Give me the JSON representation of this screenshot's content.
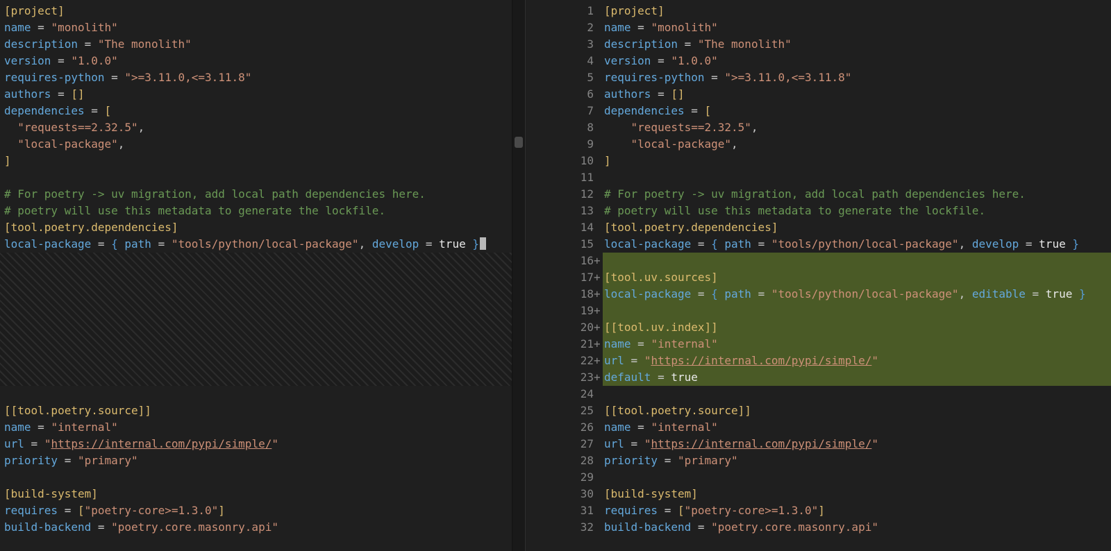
{
  "colors": {
    "background": "#1f1f1f",
    "added_line_background": "#4a5a26",
    "line_number": "#848484",
    "table_header": "#dcbb6e",
    "key": "#64a9dd",
    "string": "#ce9178",
    "comment": "#6a9955",
    "boolean": "#e9e9e9",
    "brace": "#569cd6",
    "scrollbar_thumb": "#4a4a4a"
  },
  "editor": {
    "left": {
      "lines": [
        {
          "tokens": [
            [
              "header",
              "[project]"
            ]
          ]
        },
        {
          "tokens": [
            [
              "key",
              "name"
            ],
            [
              "op",
              " = "
            ],
            [
              "str",
              "\"monolith\""
            ]
          ]
        },
        {
          "tokens": [
            [
              "key",
              "description"
            ],
            [
              "op",
              " = "
            ],
            [
              "str",
              "\"The monolith\""
            ]
          ]
        },
        {
          "tokens": [
            [
              "key",
              "version"
            ],
            [
              "op",
              " = "
            ],
            [
              "str",
              "\"1.0.0\""
            ]
          ]
        },
        {
          "tokens": [
            [
              "key",
              "requires-python"
            ],
            [
              "op",
              " = "
            ],
            [
              "str",
              "\">=3.11.0,<=3.11.8\""
            ]
          ]
        },
        {
          "tokens": [
            [
              "key",
              "authors"
            ],
            [
              "op",
              " = "
            ],
            [
              "bracket",
              "[]"
            ]
          ]
        },
        {
          "tokens": [
            [
              "key",
              "dependencies"
            ],
            [
              "op",
              " = "
            ],
            [
              "bracket",
              "["
            ]
          ]
        },
        {
          "tokens": [
            [
              "op",
              "  "
            ],
            [
              "str",
              "\"requests==2.32.5\""
            ],
            [
              "op",
              ","
            ]
          ]
        },
        {
          "tokens": [
            [
              "op",
              "  "
            ],
            [
              "str",
              "\"local-package\""
            ],
            [
              "op",
              ","
            ]
          ]
        },
        {
          "tokens": [
            [
              "bracket",
              "]"
            ]
          ]
        },
        {
          "tokens": []
        },
        {
          "tokens": [
            [
              "comment",
              "# For poetry -> uv migration, add local path dependencies here."
            ]
          ]
        },
        {
          "tokens": [
            [
              "comment",
              "# poetry will use this metadata to generate the lockfile."
            ]
          ]
        },
        {
          "tokens": [
            [
              "header",
              "[tool.poetry.dependencies]"
            ]
          ]
        },
        {
          "cursor": true,
          "tokens": [
            [
              "key",
              "local-package"
            ],
            [
              "op",
              " = "
            ],
            [
              "brace",
              "{ "
            ],
            [
              "key",
              "path"
            ],
            [
              "op",
              " = "
            ],
            [
              "str",
              "\"tools/python/local-package\""
            ],
            [
              "op",
              ", "
            ],
            [
              "key",
              "develop"
            ],
            [
              "op",
              " = "
            ],
            [
              "bool",
              "true"
            ],
            [
              "brace",
              " }"
            ]
          ]
        },
        {
          "hatch": 8
        },
        {
          "tokens": []
        },
        {
          "tokens": [
            [
              "header",
              "[[tool.poetry.source]]"
            ]
          ]
        },
        {
          "tokens": [
            [
              "key",
              "name"
            ],
            [
              "op",
              " = "
            ],
            [
              "str",
              "\"internal\""
            ]
          ]
        },
        {
          "tokens": [
            [
              "key",
              "url"
            ],
            [
              "op",
              " = "
            ],
            [
              "str",
              "\""
            ],
            [
              "link",
              "https://internal.com/pypi/simple/"
            ],
            [
              "str",
              "\""
            ]
          ]
        },
        {
          "tokens": [
            [
              "key",
              "priority"
            ],
            [
              "op",
              " = "
            ],
            [
              "str",
              "\"primary\""
            ]
          ]
        },
        {
          "tokens": []
        },
        {
          "tokens": [
            [
              "header",
              "[build-system]"
            ]
          ]
        },
        {
          "tokens": [
            [
              "key",
              "requires"
            ],
            [
              "op",
              " = "
            ],
            [
              "bracket",
              "["
            ],
            [
              "str",
              "\"poetry-core>=1.3.0\""
            ],
            [
              "bracket",
              "]"
            ]
          ]
        },
        {
          "tokens": [
            [
              "key",
              "build-backend"
            ],
            [
              "op",
              " = "
            ],
            [
              "str",
              "\"poetry.core.masonry.api\""
            ]
          ]
        }
      ]
    },
    "right": {
      "lines": [
        {
          "num": "1",
          "tokens": [
            [
              "header",
              "[project]"
            ]
          ]
        },
        {
          "num": "2",
          "tokens": [
            [
              "key",
              "name"
            ],
            [
              "op",
              " = "
            ],
            [
              "str",
              "\"monolith\""
            ]
          ]
        },
        {
          "num": "3",
          "tokens": [
            [
              "key",
              "description"
            ],
            [
              "op",
              " = "
            ],
            [
              "str",
              "\"The monolith\""
            ]
          ]
        },
        {
          "num": "4",
          "tokens": [
            [
              "key",
              "version"
            ],
            [
              "op",
              " = "
            ],
            [
              "str",
              "\"1.0.0\""
            ]
          ]
        },
        {
          "num": "5",
          "tokens": [
            [
              "key",
              "requires-python"
            ],
            [
              "op",
              " = "
            ],
            [
              "str",
              "\">=3.11.0,<=3.11.8\""
            ]
          ]
        },
        {
          "num": "6",
          "tokens": [
            [
              "key",
              "authors"
            ],
            [
              "op",
              " = "
            ],
            [
              "bracket",
              "[]"
            ]
          ]
        },
        {
          "num": "7",
          "tokens": [
            [
              "key",
              "dependencies"
            ],
            [
              "op",
              " = "
            ],
            [
              "bracket",
              "["
            ]
          ]
        },
        {
          "num": "8",
          "tokens": [
            [
              "op",
              "    "
            ],
            [
              "str",
              "\"requests==2.32.5\""
            ],
            [
              "op",
              ","
            ]
          ]
        },
        {
          "num": "9",
          "tokens": [
            [
              "op",
              "    "
            ],
            [
              "str",
              "\"local-package\""
            ],
            [
              "op",
              ","
            ]
          ]
        },
        {
          "num": "10",
          "tokens": [
            [
              "bracket",
              "]"
            ]
          ]
        },
        {
          "num": "11",
          "tokens": []
        },
        {
          "num": "12",
          "tokens": [
            [
              "comment",
              "# For poetry -> uv migration, add local path dependencies here."
            ]
          ]
        },
        {
          "num": "13",
          "tokens": [
            [
              "comment",
              "# poetry will use this metadata to generate the lockfile."
            ]
          ]
        },
        {
          "num": "14",
          "tokens": [
            [
              "header",
              "[tool.poetry.dependencies]"
            ]
          ]
        },
        {
          "num": "15",
          "tokens": [
            [
              "key",
              "local-package"
            ],
            [
              "op",
              " = "
            ],
            [
              "brace",
              "{ "
            ],
            [
              "key",
              "path"
            ],
            [
              "op",
              " = "
            ],
            [
              "str",
              "\"tools/python/local-package\""
            ],
            [
              "op",
              ", "
            ],
            [
              "key",
              "develop"
            ],
            [
              "op",
              " = "
            ],
            [
              "bool",
              "true"
            ],
            [
              "brace",
              " }"
            ]
          ]
        },
        {
          "num": "16",
          "added": true,
          "tokens": []
        },
        {
          "num": "17",
          "added": true,
          "tokens": [
            [
              "header",
              "[tool.uv.sources]"
            ]
          ]
        },
        {
          "num": "18",
          "added": true,
          "tokens": [
            [
              "key",
              "local-package"
            ],
            [
              "op",
              " = "
            ],
            [
              "brace",
              "{ "
            ],
            [
              "key",
              "path"
            ],
            [
              "op",
              " = "
            ],
            [
              "str",
              "\"tools/python/local-package\""
            ],
            [
              "op",
              ", "
            ],
            [
              "key",
              "editable"
            ],
            [
              "op",
              " = "
            ],
            [
              "bool",
              "true"
            ],
            [
              "brace",
              " }"
            ]
          ]
        },
        {
          "num": "19",
          "added": true,
          "tokens": []
        },
        {
          "num": "20",
          "added": true,
          "tokens": [
            [
              "header",
              "[[tool.uv.index]]"
            ]
          ]
        },
        {
          "num": "21",
          "added": true,
          "tokens": [
            [
              "key",
              "name"
            ],
            [
              "op",
              " = "
            ],
            [
              "str",
              "\"internal\""
            ]
          ]
        },
        {
          "num": "22",
          "added": true,
          "tokens": [
            [
              "key",
              "url"
            ],
            [
              "op",
              " = "
            ],
            [
              "str",
              "\""
            ],
            [
              "link",
              "https://internal.com/pypi/simple/"
            ],
            [
              "str",
              "\""
            ]
          ]
        },
        {
          "num": "23",
          "added": true,
          "tokens": [
            [
              "key",
              "default"
            ],
            [
              "op",
              " = "
            ],
            [
              "bool",
              "true"
            ]
          ]
        },
        {
          "num": "24",
          "tokens": []
        },
        {
          "num": "25",
          "tokens": [
            [
              "header",
              "[[tool.poetry.source]]"
            ]
          ]
        },
        {
          "num": "26",
          "tokens": [
            [
              "key",
              "name"
            ],
            [
              "op",
              " = "
            ],
            [
              "str",
              "\"internal\""
            ]
          ]
        },
        {
          "num": "27",
          "tokens": [
            [
              "key",
              "url"
            ],
            [
              "op",
              " = "
            ],
            [
              "str",
              "\""
            ],
            [
              "link",
              "https://internal.com/pypi/simple/"
            ],
            [
              "str",
              "\""
            ]
          ]
        },
        {
          "num": "28",
          "tokens": [
            [
              "key",
              "priority"
            ],
            [
              "op",
              " = "
            ],
            [
              "str",
              "\"primary\""
            ]
          ]
        },
        {
          "num": "29",
          "tokens": []
        },
        {
          "num": "30",
          "tokens": [
            [
              "header",
              "[build-system]"
            ]
          ]
        },
        {
          "num": "31",
          "tokens": [
            [
              "key",
              "requires"
            ],
            [
              "op",
              " = "
            ],
            [
              "bracket",
              "["
            ],
            [
              "str",
              "\"poetry-core>=1.3.0\""
            ],
            [
              "bracket",
              "]"
            ]
          ]
        },
        {
          "num": "32",
          "tokens": [
            [
              "key",
              "build-backend"
            ],
            [
              "op",
              " = "
            ],
            [
              "str",
              "\"poetry.core.masonry.api\""
            ]
          ]
        }
      ]
    }
  }
}
